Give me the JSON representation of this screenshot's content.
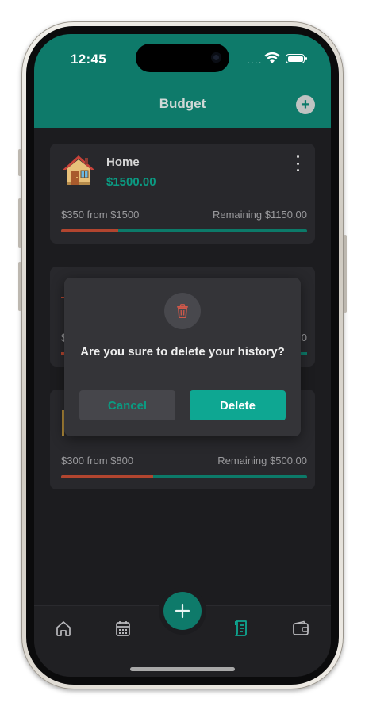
{
  "status_bar": {
    "time": "12:45",
    "signal_dots": "....",
    "wifi_icon": "wifi-icon",
    "battery_icon": "battery-icon"
  },
  "header": {
    "title": "Budget",
    "add_icon": "plus-circle-icon",
    "add_symbol": "+"
  },
  "budgets": [
    {
      "name": "Home",
      "amount": "$1500.00",
      "spent_text": "$350 from $1500",
      "remaining_text": "Remaining $1150.00",
      "progress": 0.233,
      "icon": "house-icon"
    },
    {
      "name": "",
      "amount": "",
      "spent_text": "$",
      "remaining_text": "0",
      "icon": ""
    },
    {
      "name": "",
      "amount": "",
      "spent_text": "$300 from $800",
      "remaining_text": "Remaining $500.00",
      "progress": 0.375,
      "icon": ""
    }
  ],
  "dialog": {
    "message": "Are you sure to delete your history?",
    "icon": "trash-icon",
    "cancel_label": "Cancel",
    "delete_label": "Delete"
  },
  "tabbar": {
    "items": [
      "home-icon",
      "calendar-icon",
      "receipt-icon",
      "wallet-icon"
    ],
    "active": "receipt-icon",
    "fab_icon": "plus-icon"
  },
  "colors": {
    "accent": "#0e7a6a",
    "accent_light": "#0ea792",
    "progress_spent": "#b2452f",
    "background": "#1c1c1f",
    "card": "#28282c"
  }
}
